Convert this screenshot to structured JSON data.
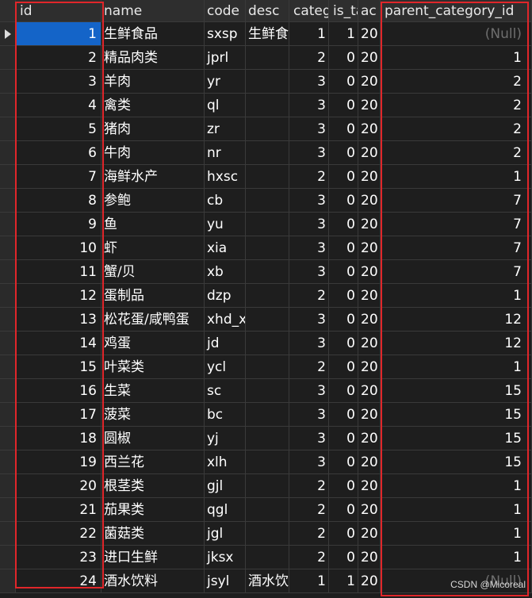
{
  "columns": {
    "id": "id",
    "name": "name",
    "code": "code",
    "desc": "desc",
    "category_type": "categ",
    "is_tab": "is_ta",
    "add_time": "ac",
    "parent_category_id": "parent_category_id"
  },
  "rows": [
    {
      "id": "1",
      "name": "生鲜食品",
      "code": "sxsp",
      "desc": "生鲜食",
      "category_type": "1",
      "is_tab": "1",
      "add_time": "20",
      "parent_category_id": "(Null)"
    },
    {
      "id": "2",
      "name": "精品肉类",
      "code": "jprl",
      "desc": "",
      "category_type": "2",
      "is_tab": "0",
      "add_time": "20",
      "parent_category_id": "1"
    },
    {
      "id": "3",
      "name": "羊肉",
      "code": "yr",
      "desc": "",
      "category_type": "3",
      "is_tab": "0",
      "add_time": "20",
      "parent_category_id": "2"
    },
    {
      "id": "4",
      "name": "禽类",
      "code": "ql",
      "desc": "",
      "category_type": "3",
      "is_tab": "0",
      "add_time": "20",
      "parent_category_id": "2"
    },
    {
      "id": "5",
      "name": "猪肉",
      "code": "zr",
      "desc": "",
      "category_type": "3",
      "is_tab": "0",
      "add_time": "20",
      "parent_category_id": "2"
    },
    {
      "id": "6",
      "name": "牛肉",
      "code": "nr",
      "desc": "",
      "category_type": "3",
      "is_tab": "0",
      "add_time": "20",
      "parent_category_id": "2"
    },
    {
      "id": "7",
      "name": "海鲜水产",
      "code": "hxsc",
      "desc": "",
      "category_type": "2",
      "is_tab": "0",
      "add_time": "20",
      "parent_category_id": "1"
    },
    {
      "id": "8",
      "name": "参鲍",
      "code": "cb",
      "desc": "",
      "category_type": "3",
      "is_tab": "0",
      "add_time": "20",
      "parent_category_id": "7"
    },
    {
      "id": "9",
      "name": "鱼",
      "code": "yu",
      "desc": "",
      "category_type": "3",
      "is_tab": "0",
      "add_time": "20",
      "parent_category_id": "7"
    },
    {
      "id": "10",
      "name": "虾",
      "code": "xia",
      "desc": "",
      "category_type": "3",
      "is_tab": "0",
      "add_time": "20",
      "parent_category_id": "7"
    },
    {
      "id": "11",
      "name": "蟹/贝",
      "code": "xb",
      "desc": "",
      "category_type": "3",
      "is_tab": "0",
      "add_time": "20",
      "parent_category_id": "7"
    },
    {
      "id": "12",
      "name": "蛋制品",
      "code": "dzp",
      "desc": "",
      "category_type": "2",
      "is_tab": "0",
      "add_time": "20",
      "parent_category_id": "1"
    },
    {
      "id": "13",
      "name": "松花蛋/咸鸭蛋",
      "code": "xhd_x",
      "desc": "",
      "category_type": "3",
      "is_tab": "0",
      "add_time": "20",
      "parent_category_id": "12"
    },
    {
      "id": "14",
      "name": "鸡蛋",
      "code": "jd",
      "desc": "",
      "category_type": "3",
      "is_tab": "0",
      "add_time": "20",
      "parent_category_id": "12"
    },
    {
      "id": "15",
      "name": "叶菜类",
      "code": "ycl",
      "desc": "",
      "category_type": "2",
      "is_tab": "0",
      "add_time": "20",
      "parent_category_id": "1"
    },
    {
      "id": "16",
      "name": "生菜",
      "code": "sc",
      "desc": "",
      "category_type": "3",
      "is_tab": "0",
      "add_time": "20",
      "parent_category_id": "15"
    },
    {
      "id": "17",
      "name": "菠菜",
      "code": "bc",
      "desc": "",
      "category_type": "3",
      "is_tab": "0",
      "add_time": "20",
      "parent_category_id": "15"
    },
    {
      "id": "18",
      "name": "圆椒",
      "code": "yj",
      "desc": "",
      "category_type": "3",
      "is_tab": "0",
      "add_time": "20",
      "parent_category_id": "15"
    },
    {
      "id": "19",
      "name": "西兰花",
      "code": "xlh",
      "desc": "",
      "category_type": "3",
      "is_tab": "0",
      "add_time": "20",
      "parent_category_id": "15"
    },
    {
      "id": "20",
      "name": "根茎类",
      "code": "gjl",
      "desc": "",
      "category_type": "2",
      "is_tab": "0",
      "add_time": "20",
      "parent_category_id": "1"
    },
    {
      "id": "21",
      "name": "茄果类",
      "code": "qgl",
      "desc": "",
      "category_type": "2",
      "is_tab": "0",
      "add_time": "20",
      "parent_category_id": "1"
    },
    {
      "id": "22",
      "name": "菌菇类",
      "code": "jgl",
      "desc": "",
      "category_type": "2",
      "is_tab": "0",
      "add_time": "20",
      "parent_category_id": "1"
    },
    {
      "id": "23",
      "name": "进口生鲜",
      "code": "jksx",
      "desc": "",
      "category_type": "2",
      "is_tab": "0",
      "add_time": "20",
      "parent_category_id": "1"
    },
    {
      "id": "24",
      "name": "酒水饮料",
      "code": "jsyl",
      "desc": "酒水饮",
      "category_type": "1",
      "is_tab": "1",
      "add_time": "20",
      "parent_category_id": "(Null)"
    }
  ],
  "selected_row_index": 0,
  "highlight_color": "#e0262a",
  "selection_color": "#1464c8",
  "watermark": "CSDN @Micoreal"
}
